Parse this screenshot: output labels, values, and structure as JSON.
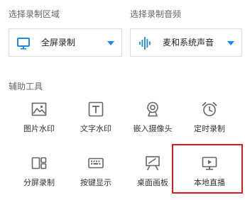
{
  "video_section": {
    "label": "选择录制区域",
    "selected": "全屏录制",
    "icon": "monitor-icon"
  },
  "audio_section": {
    "label": "选择录制音频",
    "selected": "麦和系统声音",
    "icon": "sound-wave-icon"
  },
  "tools_section": {
    "label": "辅助工具",
    "items": [
      {
        "label": "图片水印",
        "icon": "image-icon"
      },
      {
        "label": "文字水印",
        "icon": "text-icon"
      },
      {
        "label": "嵌入摄像头",
        "icon": "webcam-icon"
      },
      {
        "label": "定时录制",
        "icon": "alarm-clock-icon"
      },
      {
        "label": "分屏录制",
        "icon": "split-screen-icon"
      },
      {
        "label": "按键显示",
        "icon": "keyboard-icon"
      },
      {
        "label": "桌面画板",
        "icon": "easel-icon"
      },
      {
        "label": "本地直播",
        "icon": "live-broadcast-icon"
      }
    ]
  },
  "colors": {
    "accent": "#1e88e5",
    "icon_gray": "#666666",
    "highlight": "#e0191f"
  }
}
